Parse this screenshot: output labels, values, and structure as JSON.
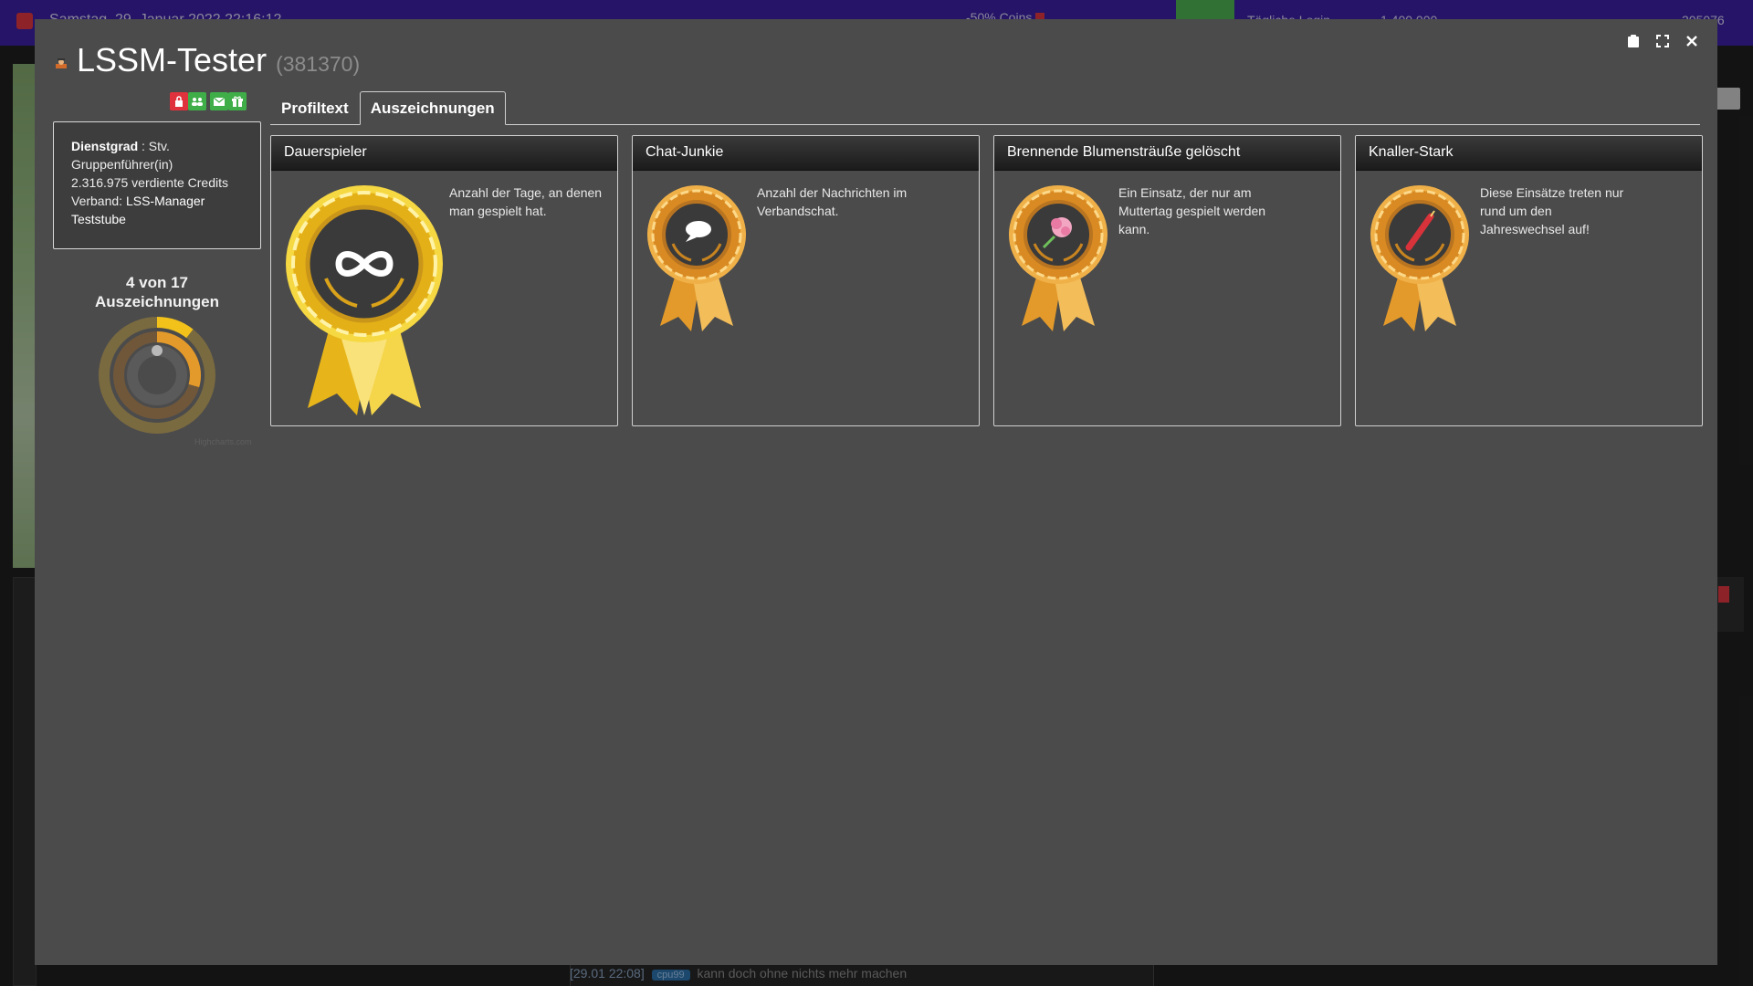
{
  "background": {
    "topbar": {
      "datetime": "Samstag, 29. Januar 2022 22:16:12",
      "coins_promo": "-50% Coins",
      "daily_label": "Tägliche Login",
      "credits_display": "1.400.000",
      "right_value": "305076"
    },
    "chat": {
      "time": "[29.01 22:08]",
      "tag": "cpu99",
      "message": "kann doch ohne nichts mehr machen"
    }
  },
  "modal": {
    "title": "LSSM-Tester",
    "user_id": "(381370)",
    "window_controls": [
      "clipboard-icon",
      "expand-icon",
      "close-icon"
    ]
  },
  "profile": {
    "rank_label": "Dienstgrad",
    "rank_value": "Stv. Gruppenführer(in)",
    "credits_text": "2.316.975 verdiente Credits",
    "alliance_label": "Verband:",
    "alliance_value": "LSS-Manager Teststube",
    "action_buttons": [
      {
        "icon": "lock-icon",
        "color": "#e0323c"
      },
      {
        "icon": "users-icon",
        "color": "#3fae49"
      },
      {
        "icon": "envelope-icon",
        "color": "#3fae49"
      },
      {
        "icon": "gift-icon",
        "color": "#3fae49"
      }
    ]
  },
  "awards_summary": {
    "count_line": "4 von 17",
    "label": "Auszeichnungen",
    "earned": 4,
    "total": 17,
    "credit_text": "Highcharts.com"
  },
  "tabs": [
    {
      "label": "Profiltext",
      "active": false
    },
    {
      "label": "Auszeichnungen",
      "active": true
    }
  ],
  "awards": [
    {
      "title": "Dauerspieler",
      "description": "Anzahl der Tage, an denen man gespielt hat.",
      "tier": "gold",
      "emblem": "infinity-icon"
    },
    {
      "title": "Chat-Junkie",
      "description": "Anzahl der Nachrichten im Verbandschat.",
      "tier": "bronze",
      "emblem": "speech-bubble-icon"
    },
    {
      "title": "Brennende Blumensträuße gelöscht",
      "description": "Ein Einsatz, der nur am Muttertag gespielt werden kann.",
      "tier": "bronze",
      "emblem": "flower-bouquet-icon"
    },
    {
      "title": "Knaller-Stark",
      "description": "Diese Einsätze treten nur rund um den Jahreswechsel auf!",
      "tier": "bronze",
      "emblem": "firecracker-icon"
    }
  ],
  "colors": {
    "modal_bg": "#4b4b4b",
    "gold": "#f2c21b",
    "bronze": "#e49a2a",
    "donut_track": "#7a6a40"
  }
}
